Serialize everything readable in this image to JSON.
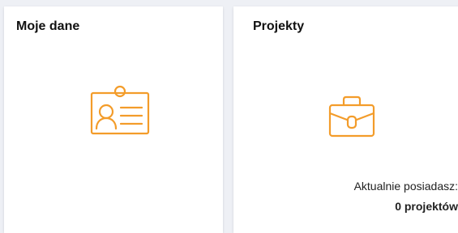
{
  "cards": [
    {
      "title": "Moje dane",
      "icon": "id-card-icon"
    },
    {
      "title": "Projekty",
      "icon": "briefcase-icon",
      "info_label": "Aktualnie posiadasz:",
      "info_value": "0 projektów"
    }
  ],
  "colors": {
    "background": "#eef0f5",
    "card": "#ffffff",
    "accent": "#f39c2a",
    "text": "#111111"
  }
}
